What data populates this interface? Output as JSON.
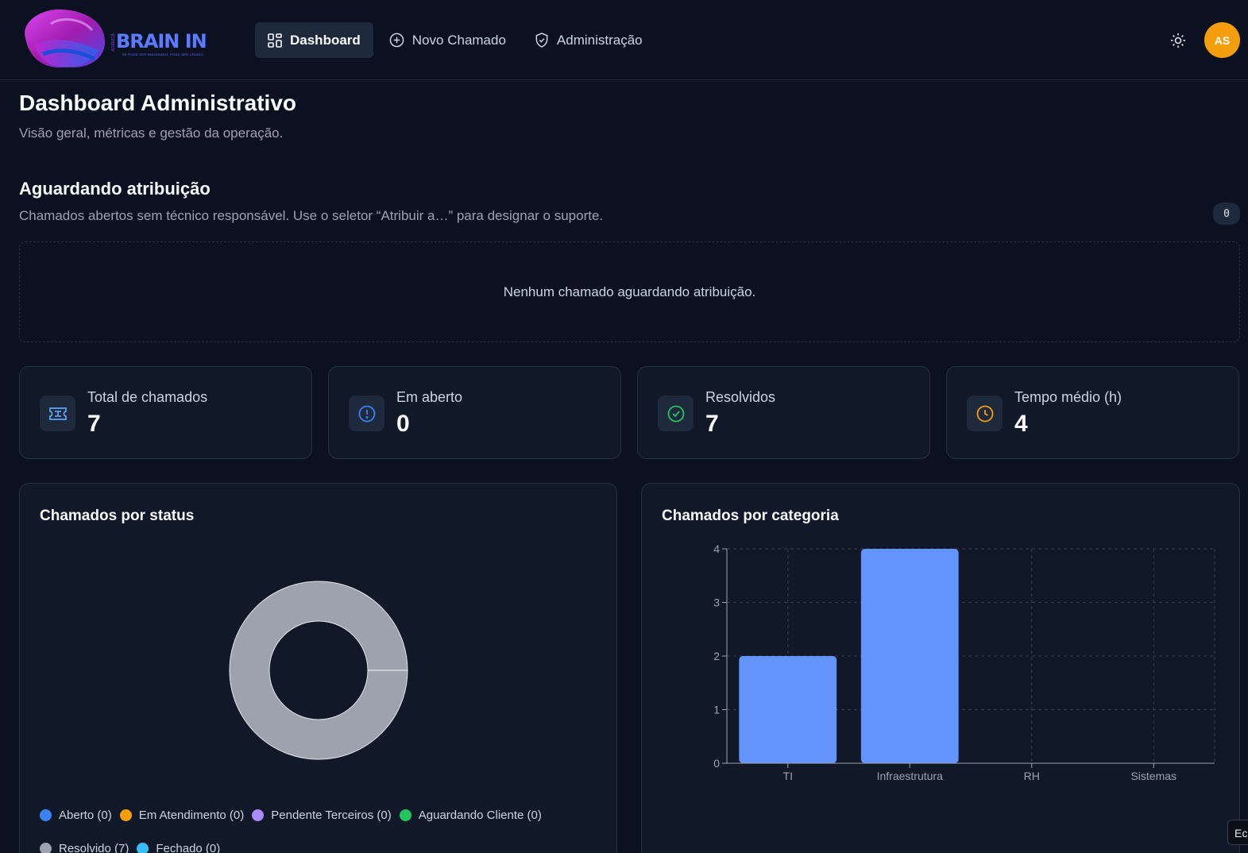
{
  "brand": {
    "name": "BRAIN IN",
    "prefix": "AGÊNCIA",
    "tagline": "SE PODE SER IMAGINADO, PODE SER CRIADO."
  },
  "nav": {
    "items": [
      {
        "label": "Dashboard",
        "icon": "dashboard-grid-icon",
        "active": true
      },
      {
        "label": "Novo Chamado",
        "icon": "plus-circle-icon",
        "active": false
      },
      {
        "label": "Administração",
        "icon": "shield-check-icon",
        "active": false
      }
    ]
  },
  "user": {
    "initials": "AS",
    "avatar_color": "#f59e0b"
  },
  "theme_toggle_icon": "sun-icon",
  "page": {
    "title": "Dashboard Administrativo",
    "subtitle": "Visão geral, métricas e gestão da operação."
  },
  "awaiting": {
    "title": "Aguardando atribuição",
    "description": "Chamados abertos sem técnico responsável. Use o seletor “Atribuir a…” para designar o suporte.",
    "count": "0",
    "empty_message": "Nenhum chamado aguardando atribuição."
  },
  "stats": [
    {
      "label": "Total de chamados",
      "value": "7",
      "icon": "ticket-icon",
      "color": "#60a5fa"
    },
    {
      "label": "Em aberto",
      "value": "0",
      "icon": "alert-circle-icon",
      "color": "#3b82f6"
    },
    {
      "label": "Resolvidos",
      "value": "7",
      "icon": "check-circle-icon",
      "color": "#22c55e"
    },
    {
      "label": "Tempo médio (h)",
      "value": "4",
      "icon": "clock-icon",
      "color": "#f59e0b"
    }
  ],
  "colors": {
    "bar": "#6495ff",
    "donut": "#9ca3af"
  },
  "corner_tag": "Ec",
  "chart_data": [
    {
      "type": "pie",
      "title": "Chamados por status",
      "donut": true,
      "categories": [
        "Aberto",
        "Em Atendimento",
        "Pendente Terceiros",
        "Aguardando Cliente",
        "Resolvido",
        "Fechado"
      ],
      "values": [
        0,
        0,
        0,
        0,
        7,
        0
      ],
      "legend_labels": [
        "Aberto (0)",
        "Em Atendimento (0)",
        "Pendente Terceiros (0)",
        "Aguardando Cliente (0)",
        "Resolvido (7)",
        "Fechado (0)"
      ],
      "colors": [
        "#3b82f6",
        "#f59e0b",
        "#a78bfa",
        "#22c55e",
        "#9ca3af",
        "#38bdf8"
      ],
      "legend_position": "bottom"
    },
    {
      "type": "bar",
      "title": "Chamados por categoria",
      "categories": [
        "TI",
        "Infraestrutura",
        "RH",
        "Sistemas"
      ],
      "values": [
        2,
        4,
        0,
        0
      ],
      "ylim": [
        0,
        4
      ],
      "yticks": [
        0,
        1,
        2,
        3,
        4
      ],
      "grid": true
    }
  ]
}
